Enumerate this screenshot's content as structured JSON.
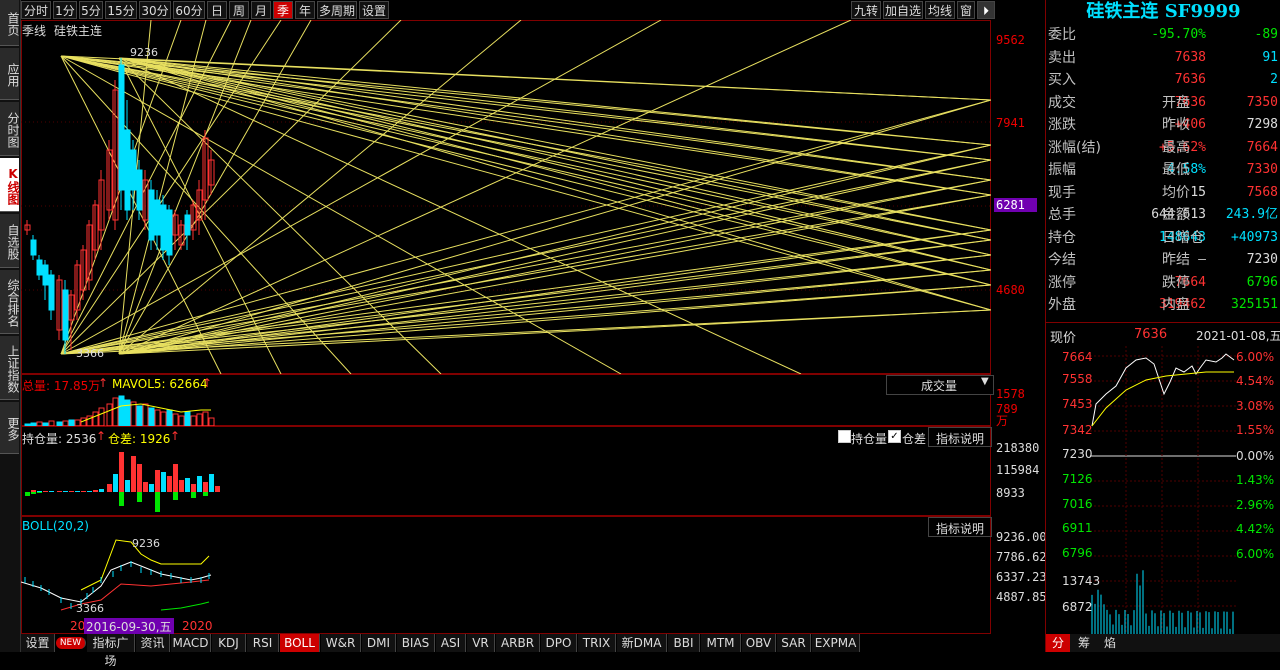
{
  "sidebar": {
    "tabs": [
      {
        "label": "首页"
      },
      {
        "label": "应用"
      },
      {
        "label": "分时图"
      },
      {
        "label": "K线图"
      },
      {
        "label": "自选股"
      },
      {
        "label": "综合排名"
      },
      {
        "label": "上证指数"
      },
      {
        "label": "更多"
      }
    ]
  },
  "period_bar": {
    "left": [
      "分时",
      "1分",
      "5分",
      "15分",
      "30分",
      "60分",
      "日",
      "周",
      "月",
      "季",
      "年",
      "多周期",
      "设置"
    ],
    "active": "季",
    "right": [
      "九转",
      "加自选",
      "均线",
      "窗"
    ]
  },
  "main_chart": {
    "period_label": "季线",
    "symbol_label": "硅铁主连",
    "high_label": "9236",
    "low_label": "3366",
    "price_axis": [
      "9562",
      "7941",
      "6281",
      "4680"
    ],
    "current_marker": "6281"
  },
  "volume_pane": {
    "total_label": "总量: 17.85万",
    "mavol_label": "MAVOL5: 62664",
    "selector": "成交量",
    "axis": [
      "1578",
      "789",
      "万"
    ]
  },
  "oi_pane": {
    "oi_label": "持仓量: 2536",
    "diff_label": "仓差: 1926",
    "checkbox_oi": "持仓量",
    "checkbox_diff": "仓差",
    "explain": "指标说明",
    "axis": [
      "218380",
      "115984",
      "8933"
    ]
  },
  "boll_pane": {
    "label": "BOLL(20,2)",
    "explain": "指标说明",
    "high": "9236",
    "low": "3366",
    "axis": [
      "9236.00",
      "7786.62",
      "6337.23",
      "4887.85"
    ],
    "date_prefix": "20",
    "date_highlight": "2016-09-30,五",
    "date_end": "2020"
  },
  "bottom_tabs": {
    "items": [
      "设置",
      "NEW",
      "指标广场",
      "资讯",
      "MACD",
      "KDJ",
      "RSI",
      "BOLL",
      "W&R",
      "DMI",
      "BIAS",
      "ASI",
      "VR",
      "ARBR",
      "DPO",
      "TRIX",
      "新DMA",
      "BBI",
      "MTM",
      "OBV",
      "SAR",
      "EXPMA"
    ],
    "active": "BOLL"
  },
  "quote": {
    "title": "硅铁主连 SF9999",
    "rows": [
      {
        "l1": "委比",
        "v1": "-95.70%",
        "v2": "-89"
      },
      {
        "l1": "卖出",
        "v1": "7638",
        "v2": "91"
      },
      {
        "l1": "买入",
        "v1": "7636",
        "v2": "2"
      },
      {
        "l1": "成交",
        "v1": "7636",
        "l2": "开盘",
        "v2": "7350"
      },
      {
        "l1": "涨跌",
        "v1": "+406",
        "l2": "昨收",
        "v2": "7298"
      },
      {
        "l1": "涨幅(结)",
        "v1": "+5.62%",
        "l2": "最高",
        "v2": "7664"
      },
      {
        "l1": "振幅",
        "v1": "4.58%",
        "l2": "最低",
        "v2": "7330"
      },
      {
        "l1": "现手",
        "v1": "15",
        "l2": "均价",
        "v2": "7568"
      },
      {
        "l1": "总手",
        "v1": "644,613",
        "l2": "金额",
        "v2": "243.9亿"
      },
      {
        "l1": "持仓",
        "v1": "148643",
        "l2": "日增仓",
        "v2": "+40973"
      },
      {
        "l1": "今结",
        "v1": "—",
        "l2": "昨结",
        "v2": "7230"
      },
      {
        "l1": "涨停",
        "v1": "7664",
        "l2": "跌停",
        "v2": "6796"
      },
      {
        "l1": "外盘",
        "v1": "319462",
        "l2": "内盘",
        "v2": "325151"
      }
    ],
    "mini": {
      "label": "现价",
      "price": "7636",
      "date": "2021-01-08,五",
      "axis_left": [
        "7664",
        "7558",
        "7453",
        "7342",
        "7230",
        "7126",
        "7016",
        "6911",
        "6796",
        "13743",
        "6872"
      ],
      "axis_right": [
        "6.00%",
        "4.54%",
        "3.08%",
        "1.55%",
        "0.00%",
        "1.43%",
        "2.96%",
        "4.42%",
        "6.00%"
      ],
      "tabs": [
        "分",
        "筹",
        "焰"
      ]
    }
  }
}
